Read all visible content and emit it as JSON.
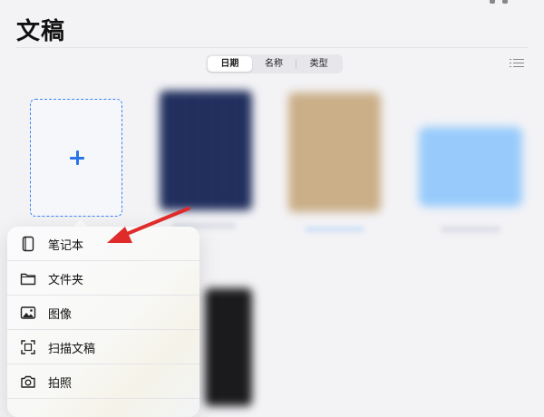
{
  "header": {
    "title": "文稿"
  },
  "sort": {
    "tabs": [
      "日期",
      "名称",
      "类型"
    ],
    "selected": "日期"
  },
  "toolbar": {
    "view_toggle_icon": "list-icon"
  },
  "new_document": {
    "icon": "plus-icon"
  },
  "menu": {
    "items": [
      {
        "label": "笔记本",
        "icon": "notebook-icon"
      },
      {
        "label": "文件夹",
        "icon": "folder-icon"
      },
      {
        "label": "图像",
        "icon": "image-icon"
      },
      {
        "label": "扫描文稿",
        "icon": "scan-icon"
      },
      {
        "label": "拍照",
        "icon": "camera-icon"
      }
    ]
  },
  "colors": {
    "accent": "#2b74e8",
    "annotation_arrow": "#e02b2b",
    "navy_cover": "#1f2d5c",
    "beige_cover": "#c9ad85",
    "folder": "#98cbfb"
  }
}
